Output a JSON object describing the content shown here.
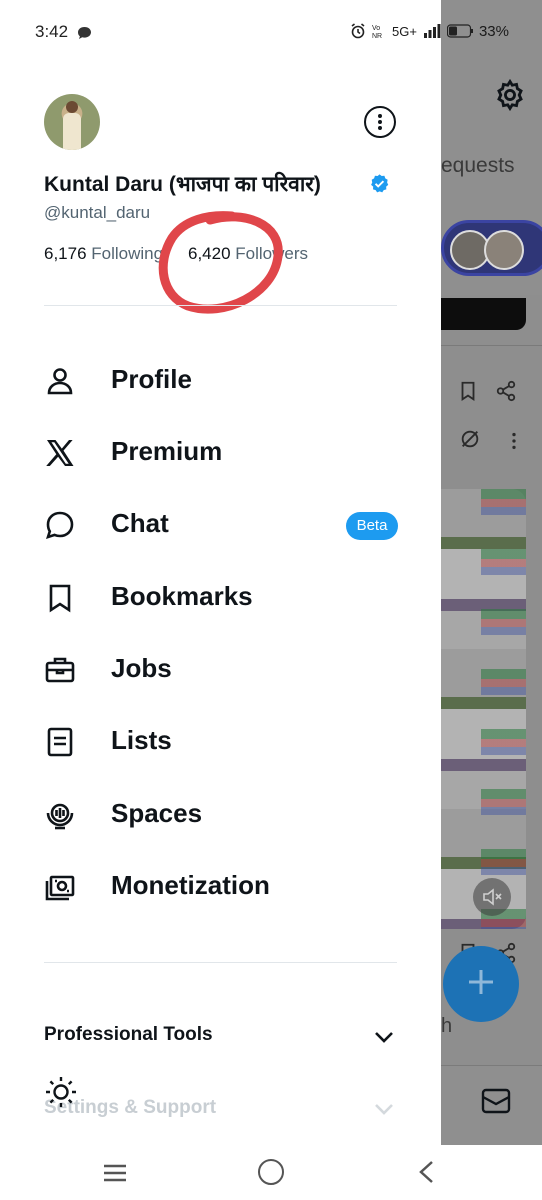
{
  "status_bar": {
    "time": "3:42",
    "network_info": "5G+",
    "battery": "33%"
  },
  "profile": {
    "display_name": "Kuntal Daru (भाजपा का परिवार)",
    "handle": "@kuntal_daru",
    "following_count": "6,176",
    "following_label": "Following",
    "followers_count": "6,420",
    "followers_label": "Followers",
    "verified": true,
    "verified_color": "#1d9bf0"
  },
  "menu": {
    "items": [
      {
        "label": "Profile",
        "icon": "person-icon"
      },
      {
        "label": "Premium",
        "icon": "x-logo-icon"
      },
      {
        "label": "Chat",
        "icon": "chat-bubble-icon",
        "badge": "Beta"
      },
      {
        "label": "Bookmarks",
        "icon": "bookmark-icon"
      },
      {
        "label": "Jobs",
        "icon": "briefcase-icon"
      },
      {
        "label": "Lists",
        "icon": "list-icon"
      },
      {
        "label": "Spaces",
        "icon": "spaces-mic-icon"
      },
      {
        "label": "Monetization",
        "icon": "money-icon"
      }
    ]
  },
  "sections": {
    "professional_tools": "Professional Tools",
    "settings_support": "Settings & Support"
  },
  "background": {
    "tab_text": "equests",
    "bottom_text": "h"
  },
  "colors": {
    "accent": "#1d9bf0",
    "annotation_red": "#e0464a",
    "scrim": "#8e8e8e",
    "fab": "#1d72b5"
  }
}
